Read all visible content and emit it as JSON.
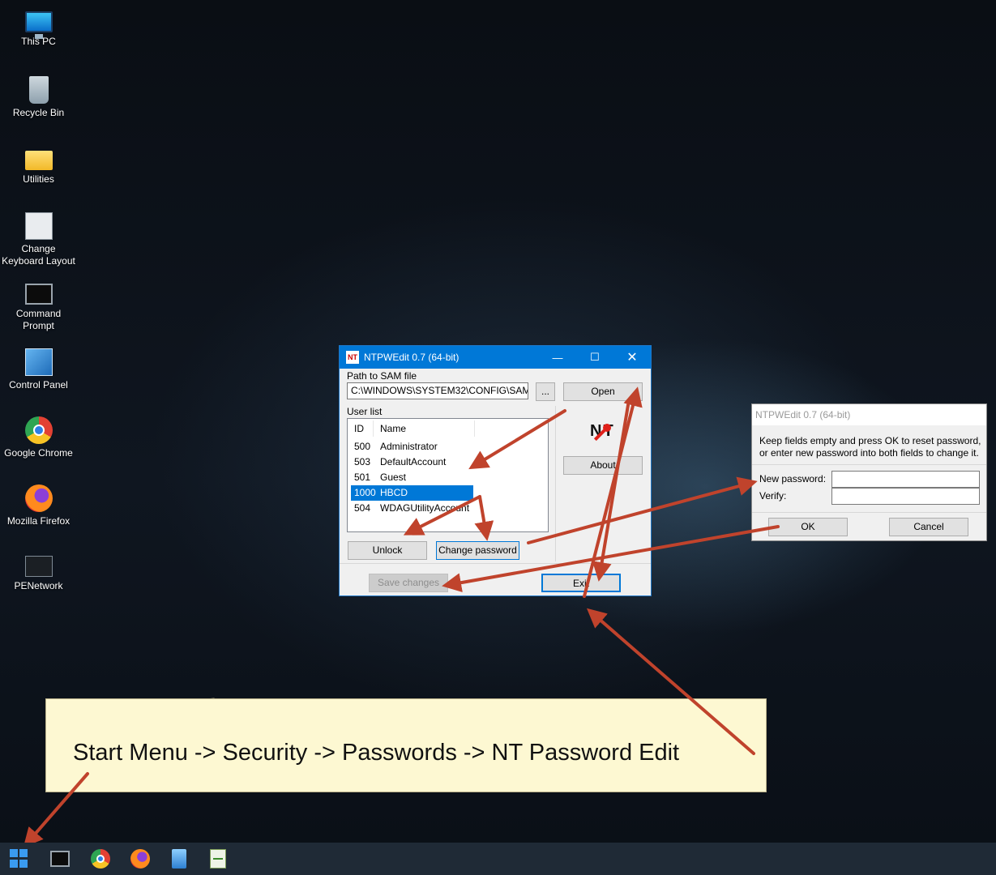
{
  "desktop": {
    "icons": [
      {
        "label": "This PC",
        "icon": "computer-icon"
      },
      {
        "label": "Recycle Bin",
        "icon": "recycle-bin-icon"
      },
      {
        "label": "Utilities",
        "icon": "folder-icon"
      },
      {
        "label": "Change Keyboard Layout",
        "icon": "keyboard-settings-icon"
      },
      {
        "label": "Command Prompt",
        "icon": "command-prompt-icon"
      },
      {
        "label": "Control Panel",
        "icon": "control-panel-icon"
      },
      {
        "label": "Google Chrome",
        "icon": "chrome-icon"
      },
      {
        "label": "Mozilla Firefox",
        "icon": "firefox-icon"
      },
      {
        "label": "PENetwork",
        "icon": "network-icon"
      }
    ]
  },
  "main_window": {
    "title": "NTPWEdit 0.7 (64-bit)",
    "path_label": "Path to SAM file",
    "path_value": "C:\\WINDOWS\\SYSTEM32\\CONFIG\\SAM",
    "browse_label": "...",
    "open_label": "Open",
    "user_list_label": "User list",
    "columns": {
      "id": "ID",
      "name": "Name"
    },
    "users": [
      {
        "id": "500",
        "name": "Administrator"
      },
      {
        "id": "503",
        "name": "DefaultAccount"
      },
      {
        "id": "501",
        "name": "Guest"
      },
      {
        "id": "1000",
        "name": "HBCD"
      },
      {
        "id": "504",
        "name": "WDAGUtilityAccount"
      }
    ],
    "selected_user_index": 3,
    "logo_text": "NT",
    "about_label": "About",
    "unlock_label": "Unlock",
    "change_password_label": "Change password",
    "save_changes_label": "Save changes",
    "exit_label": "Exit"
  },
  "password_dialog": {
    "title": "NTPWEdit 0.7 (64-bit)",
    "instruction_line1": "Keep fields empty and press OK to reset password,",
    "instruction_line2": "or enter new password into both fields to change it.",
    "new_password_label": "New password:",
    "new_password_value": "",
    "verify_label": "Verify:",
    "verify_value": "",
    "ok_label": "OK",
    "cancel_label": "Cancel"
  },
  "note": {
    "text": "Start Menu -> Security -> Passwords -> NT Password Edit"
  },
  "taskbar": {
    "items": [
      "start-icon",
      "command-prompt-icon",
      "chrome-icon",
      "firefox-icon",
      "notepad-icon",
      "task-manager-icon"
    ]
  },
  "colors": {
    "accent": "#0078d7",
    "arrow": "#c0432c",
    "note_background": "#fdf8d2",
    "taskbar": "#1f2a36"
  }
}
